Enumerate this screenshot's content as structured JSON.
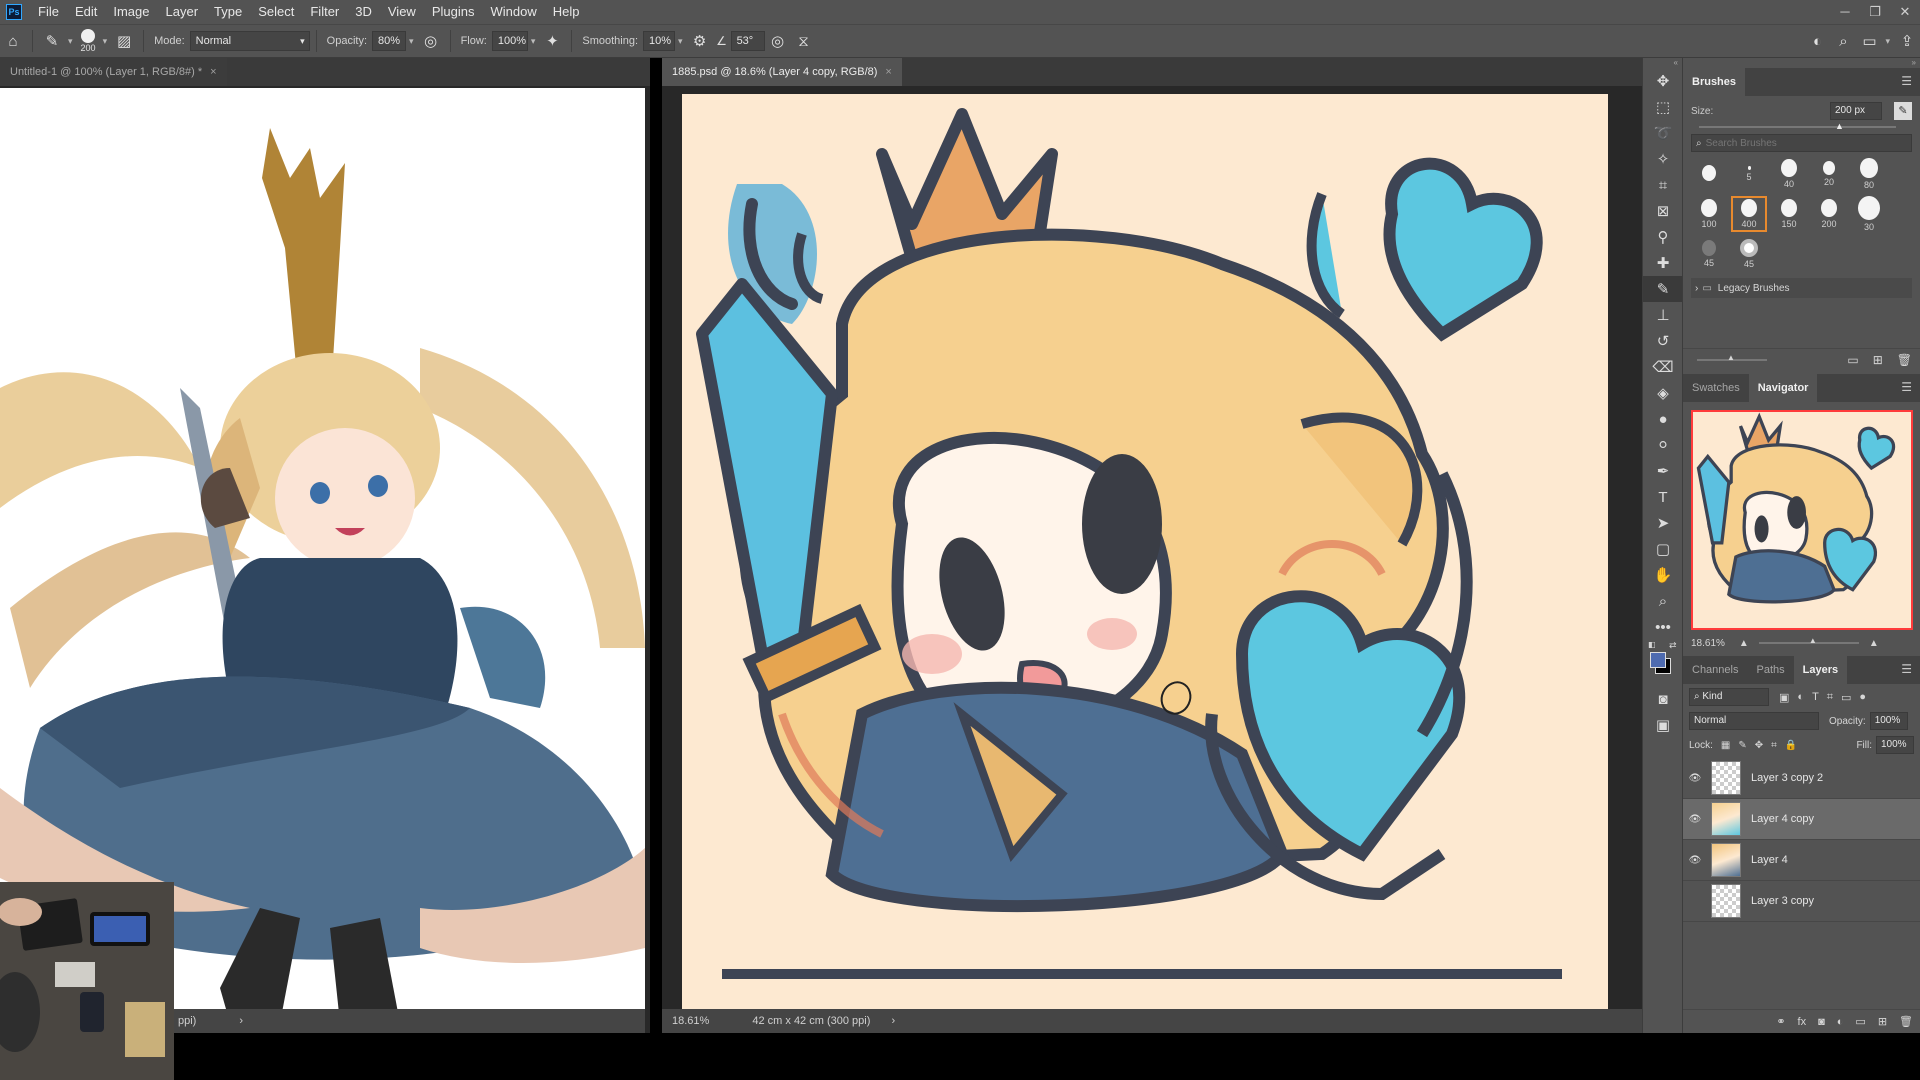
{
  "menu": {
    "logo": "Ps",
    "items": [
      "File",
      "Edit",
      "Image",
      "Layer",
      "Type",
      "Select",
      "Filter",
      "3D",
      "View",
      "Plugins",
      "Window",
      "Help"
    ]
  },
  "window_controls": {
    "minimize": "─",
    "restore": "❐",
    "close": "✕"
  },
  "options": {
    "brush_size": "200",
    "mode_label": "Mode:",
    "mode_value": "Normal",
    "opacity_label": "Opacity:",
    "opacity_value": "80%",
    "flow_label": "Flow:",
    "flow_value": "100%",
    "smoothing_label": "Smoothing:",
    "smoothing_value": "10%",
    "angle_value": "53°"
  },
  "documents": {
    "left_tab": "Untitled-1 @ 100% (Layer 1, RGB/8#) *",
    "right_tab": "1885.psd @ 18.6% (Layer 4 copy, RGB/8)",
    "left_status": "ppi)",
    "right_zoom": "18.61%",
    "right_size": "42 cm x 42 cm (300 ppi)"
  },
  "brushes_panel": {
    "title": "Brushes",
    "size_label": "Size:",
    "size_value": "200 px",
    "search_placeholder": "Search Brushes",
    "tips": [
      {
        "size": "",
        "dia": 14
      },
      {
        "size": "5",
        "dia": 3
      },
      {
        "size": "40",
        "dia": 16
      },
      {
        "size": "20",
        "dia": 12
      },
      {
        "size": "80",
        "dia": 18
      },
      {
        "size": "100",
        "dia": 16
      },
      {
        "size": "400",
        "dia": 16
      },
      {
        "size": "150",
        "dia": 16
      },
      {
        "size": "200",
        "dia": 16
      },
      {
        "size": "30",
        "dia": 22
      },
      {
        "size": "45",
        "dia": 14
      },
      {
        "size": "45",
        "dia": 18
      }
    ],
    "legacy_folder": "Legacy Brushes"
  },
  "navigator_panel": {
    "tabs": [
      "Swatches",
      "Navigator"
    ],
    "zoom": "18.61%"
  },
  "layers_panel": {
    "tabs": [
      "Channels",
      "Paths",
      "Layers"
    ],
    "filter_kind": "Kind",
    "blend_mode": "Normal",
    "opacity_label": "Opacity:",
    "opacity_value": "100%",
    "lock_label": "Lock:",
    "fill_label": "Fill:",
    "fill_value": "100%",
    "layers": [
      {
        "name": "Layer 3 copy 2",
        "visible": true,
        "selected": false,
        "thumb": "checker"
      },
      {
        "name": "Layer 4 copy",
        "visible": true,
        "selected": true,
        "thumb": "art"
      },
      {
        "name": "Layer 4",
        "visible": true,
        "selected": false,
        "thumb": "art2"
      },
      {
        "name": "Layer 3 copy",
        "visible": false,
        "selected": false,
        "thumb": "checker"
      }
    ]
  },
  "colors": {
    "foreground": "#4e6bb0",
    "background": "#000000",
    "canvas_bg": "#fde9d1",
    "accent_select": "#e88a2e"
  }
}
